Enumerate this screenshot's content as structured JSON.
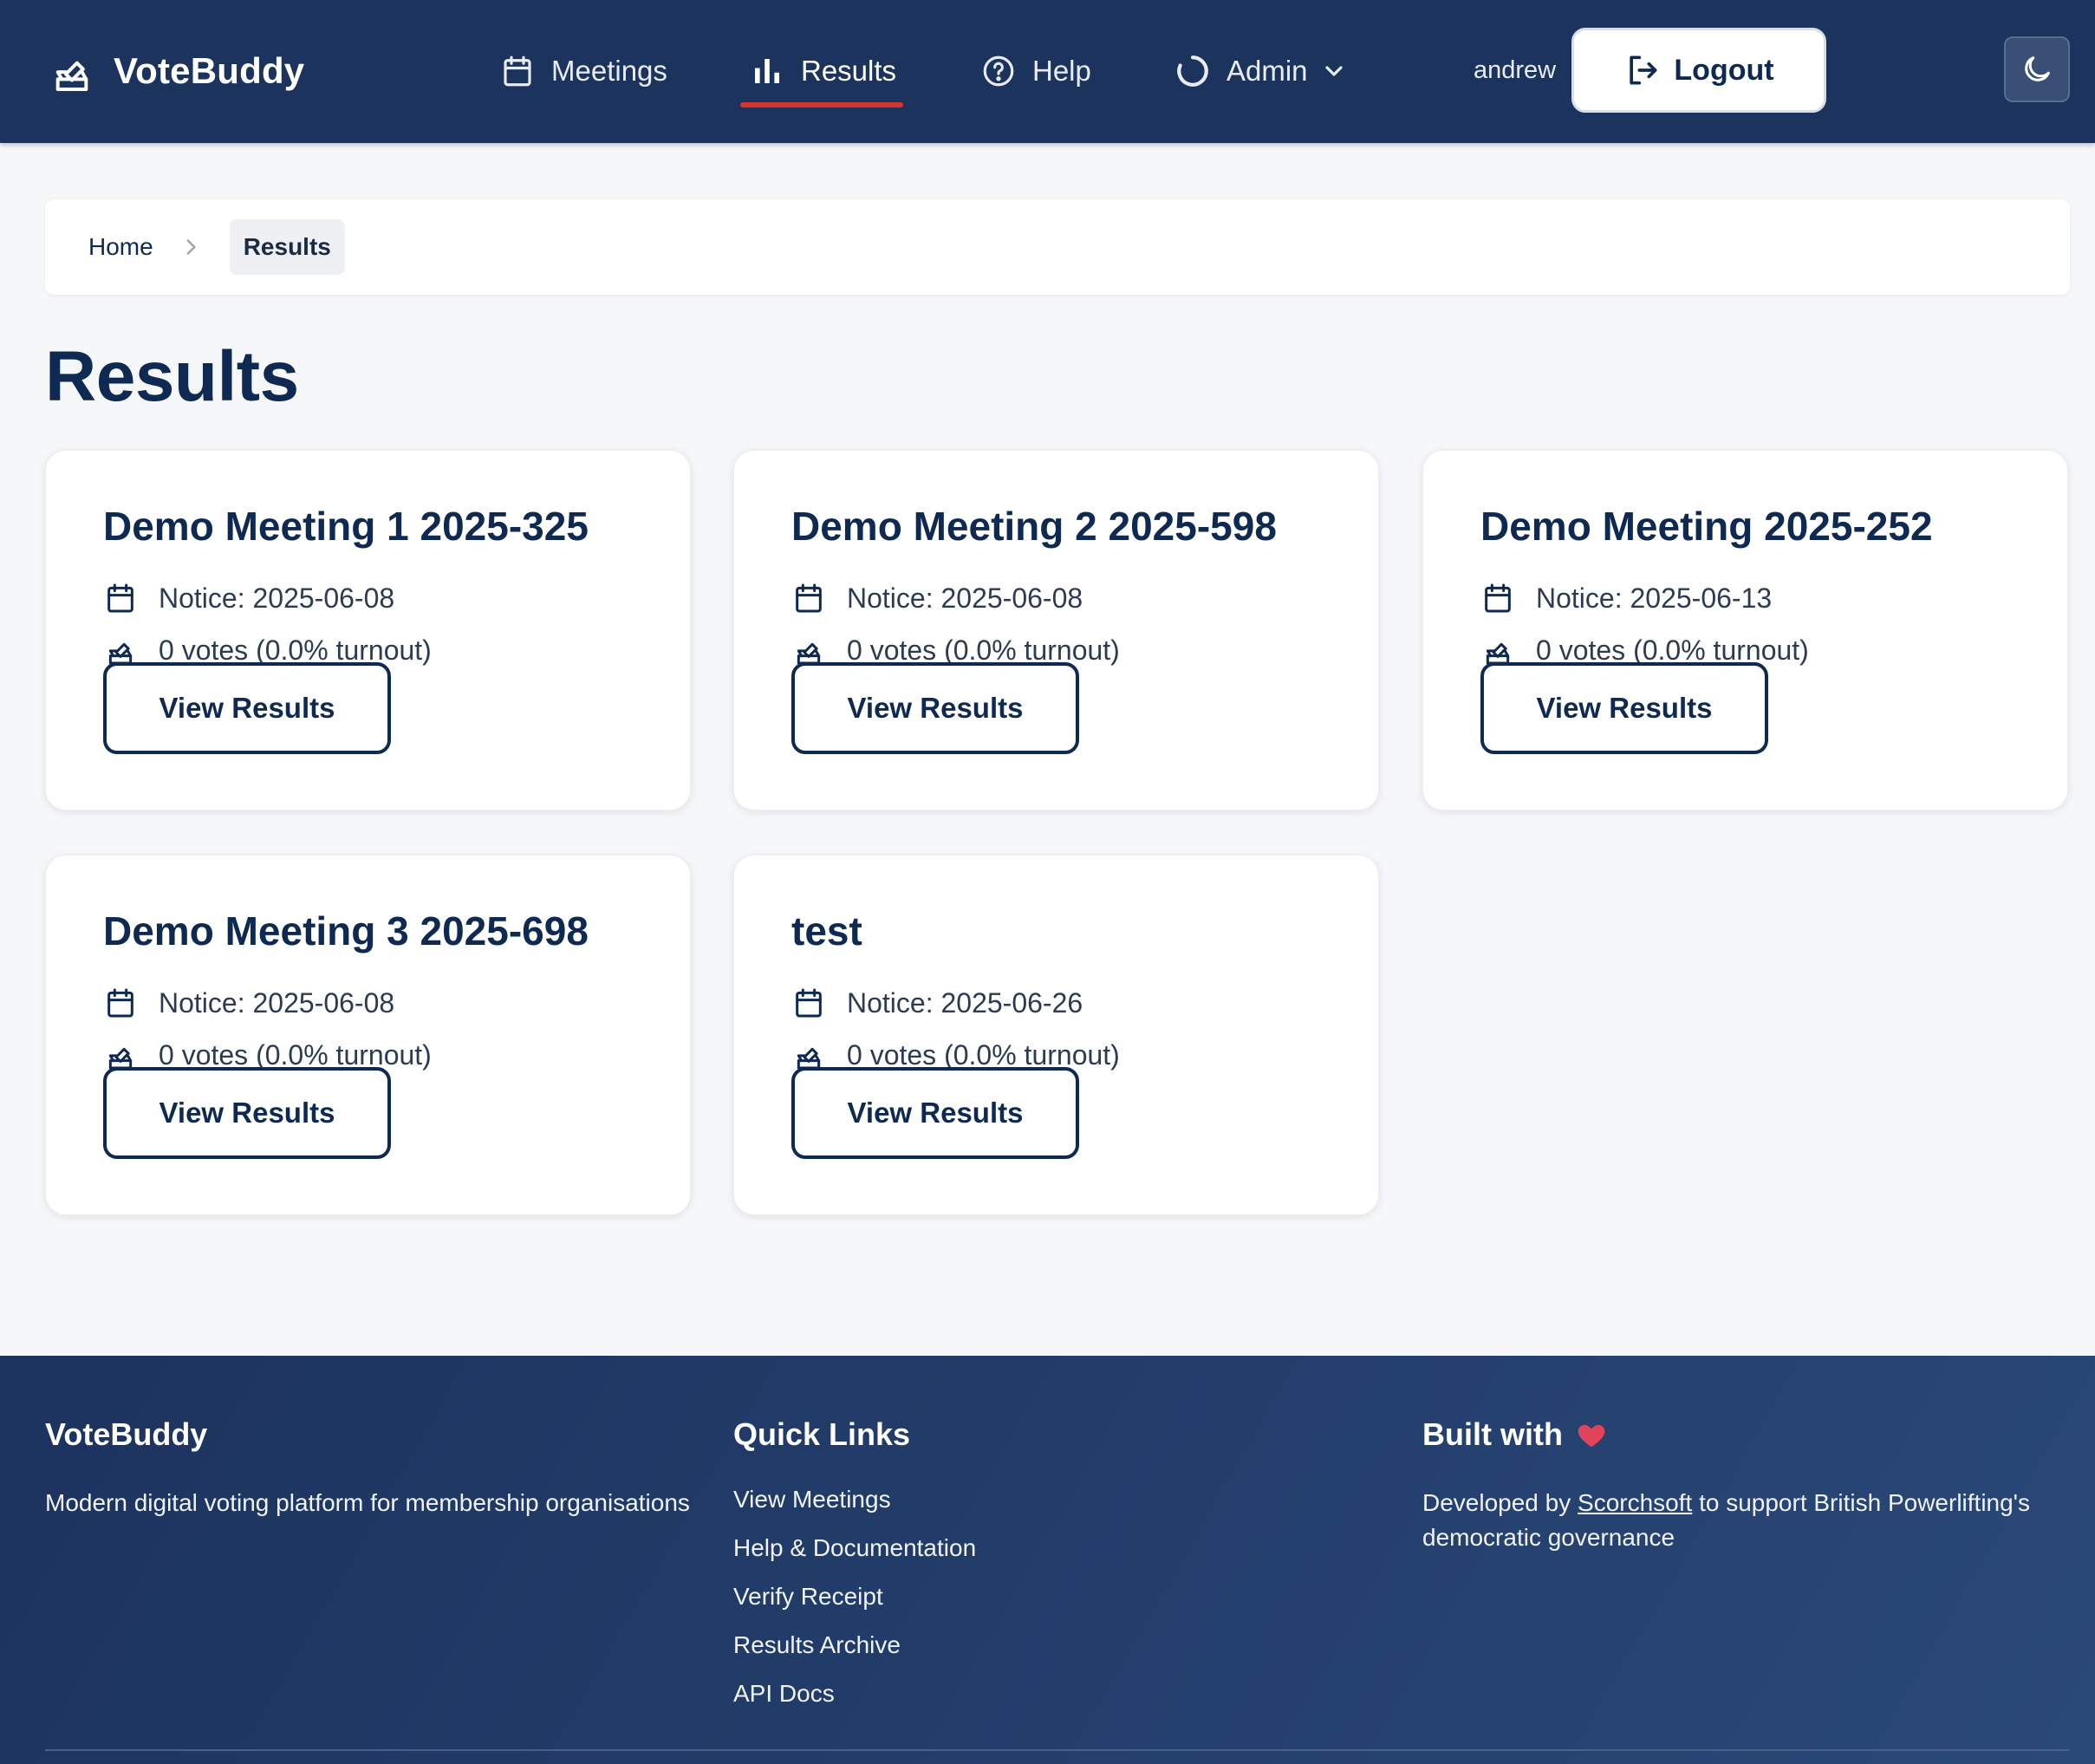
{
  "app": {
    "name": "VoteBuddy"
  },
  "nav": {
    "meetings": "Meetings",
    "results": "Results",
    "help": "Help",
    "admin": "Admin",
    "user": "andrew",
    "logout": "Logout",
    "active_color": "#d7322e"
  },
  "breadcrumb": {
    "home": "Home",
    "current": "Results"
  },
  "page": {
    "title": "Results"
  },
  "cards": [
    {
      "title": "Demo Meeting 1 2025-325",
      "notice": "Notice: 2025-06-08",
      "votes": "0 votes (0.0% turnout)",
      "button": "View Results"
    },
    {
      "title": "Demo Meeting 2 2025-598",
      "notice": "Notice: 2025-06-08",
      "votes": "0 votes (0.0% turnout)",
      "button": "View Results"
    },
    {
      "title": "Demo Meeting 2025-252",
      "notice": "Notice: 2025-06-13",
      "votes": "0 votes (0.0% turnout)",
      "button": "View Results"
    },
    {
      "title": "Demo Meeting 3 2025-698",
      "notice": "Notice: 2025-06-08",
      "votes": "0 votes (0.0% turnout)",
      "button": "View Results"
    },
    {
      "title": "test",
      "notice": "Notice: 2025-06-26",
      "votes": "0 votes (0.0% turnout)",
      "button": "View Results"
    }
  ],
  "footer": {
    "brand_heading": "VoteBuddy",
    "brand_text": "Modern digital voting platform for membership organisations",
    "links_heading": "Quick Links",
    "links": [
      "View Meetings",
      "Help & Documentation",
      "Verify Receipt",
      "Results Archive",
      "API Docs"
    ],
    "built_heading": "Built with",
    "built_prefix": "Developed by ",
    "built_link": "Scorchsoft",
    "built_suffix": " to support British Powerlifting's democratic governance"
  },
  "colors": {
    "navy": "#1c335e",
    "text_navy": "#0f2a52",
    "heart": "#e0435a"
  }
}
